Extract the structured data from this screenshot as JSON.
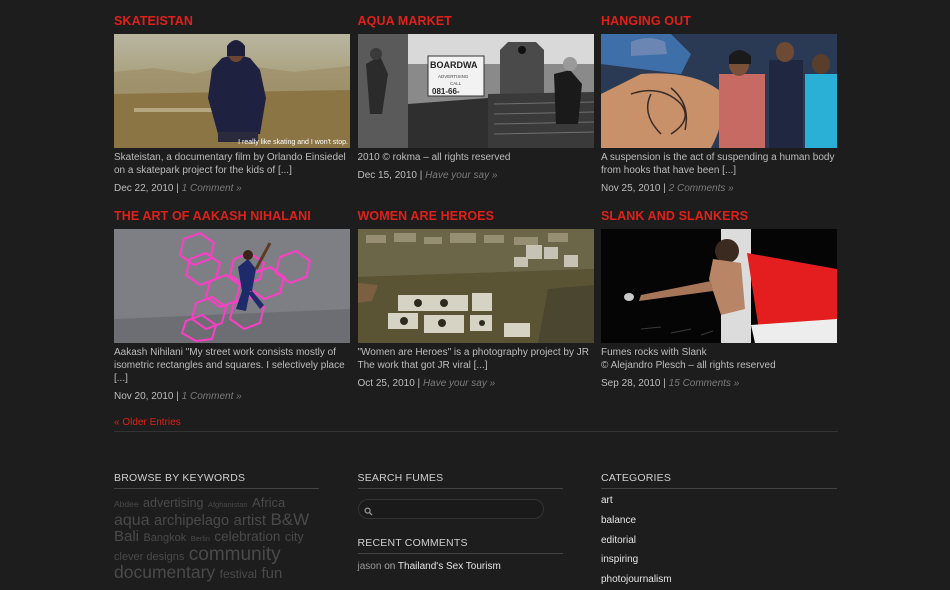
{
  "posts": [
    {
      "title": "SKATEISTAN",
      "excerpt": "Skateistan, a documentary film by Orlando Einsiedel on a skatepark project for the kids of [...]",
      "date": "Dec 22, 2010",
      "comments": "1 Comment »",
      "caption": "I really like skating and I won't stop."
    },
    {
      "title": "AQUA MARKET",
      "excerpt": "2010 © rokma – all rights reserved",
      "date": "Dec 15, 2010",
      "comments": "Have your say »",
      "sign_top": "BOARDWA",
      "sign_mid": "ADVERTISING",
      "sign_call": "CALL",
      "sign_num": "081-66-"
    },
    {
      "title": "HANGING OUT",
      "excerpt": "A suspension is the act of suspending a human body from hooks that have been [...]",
      "date": "Nov 25, 2010",
      "comments": "2 Comments »"
    },
    {
      "title": "THE ART OF AAKASH NIHALANI",
      "excerpt": "Aakash Nihilani \"My street work consists mostly of isometric rectangles and squares. I selectively place [...]",
      "date": "Nov 20, 2010",
      "comments": "1 Comment »"
    },
    {
      "title": "WOMEN ARE HEROES",
      "excerpt": "\"Women are Heroes\" is a photography project by JR The work that got JR viral [...]",
      "date": "Oct 25, 2010",
      "comments": "Have your say »"
    },
    {
      "title": "SLANK AND SLANKERS",
      "excerpt": "Fumes rocks with Slank\n© Alejandro Plesch – all rights reserved",
      "date": "Sep 28, 2010",
      "comments": "15 Comments »"
    }
  ],
  "date_sep": "|",
  "older_entries": "« Older Entries",
  "browse": {
    "title": "BROWSE BY KEYWORDS",
    "tags": [
      {
        "t": "Abdee",
        "s": 8.5
      },
      {
        "t": "advertising",
        "s": 12.5
      },
      {
        "t": "Afghanistan",
        "s": 7.5
      },
      {
        "t": "Africa",
        "s": 13
      },
      {
        "t": "aqua",
        "s": 16
      },
      {
        "t": "archipelago",
        "s": 14.5
      },
      {
        "t": "artist",
        "s": 15
      },
      {
        "t": "B&W",
        "s": 17
      },
      {
        "t": "Bali",
        "s": 15
      },
      {
        "t": "Bangkok",
        "s": 11
      },
      {
        "t": "Berlin",
        "s": 7.5
      },
      {
        "t": "celebration",
        "s": 13.5
      },
      {
        "t": "city",
        "s": 12.5
      },
      {
        "t": "clever designs",
        "s": 11
      },
      {
        "t": "community",
        "s": 19
      },
      {
        "t": "documentary",
        "s": 17.5
      },
      {
        "t": "festival",
        "s": 12
      },
      {
        "t": "fun",
        "s": 15
      }
    ]
  },
  "search": {
    "title": "SEARCH FUMES",
    "placeholder": ""
  },
  "recent": {
    "title": "RECENT COMMENTS",
    "items": [
      {
        "author": "jason",
        "on": "on",
        "post": "Thailand's Sex Tourism"
      }
    ]
  },
  "categories": {
    "title": "CATEGORIES",
    "items": [
      "art",
      "balance",
      "editorial",
      "inspiring",
      "photojournalism"
    ]
  },
  "colors": {
    "accent": "#e0201a",
    "bg": "#1d1d1d"
  }
}
